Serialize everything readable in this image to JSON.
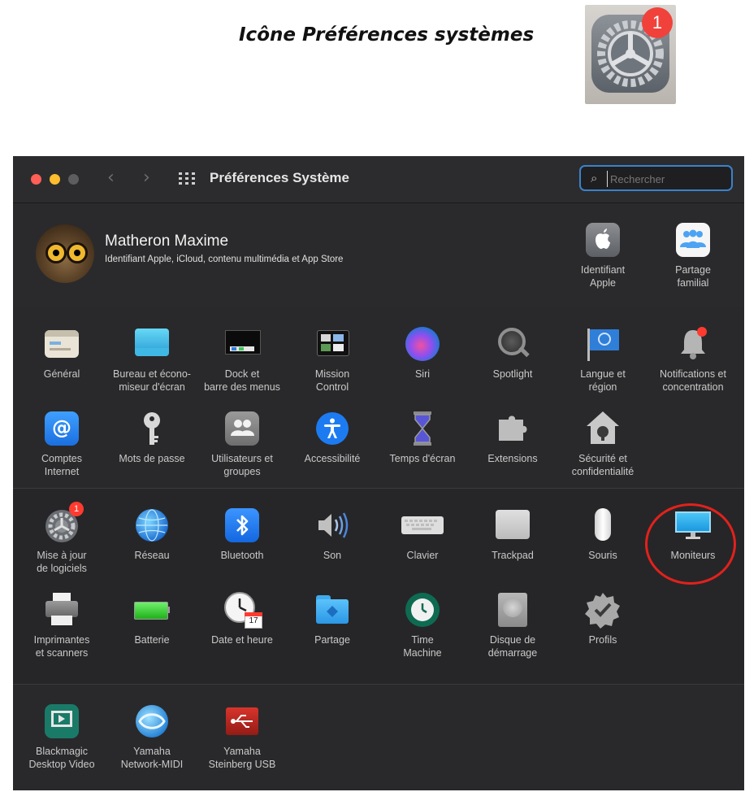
{
  "caption": "Icône Préférences systèmes",
  "app_icon": {
    "badge": "1",
    "icon": "system-preferences-gear-icon"
  },
  "window": {
    "title": "Préférences Système",
    "search_placeholder": "Rechercher",
    "traffic_lights": {
      "close": "#ff5f57",
      "minimize": "#febc2e",
      "zoom": "#5d5d5f"
    }
  },
  "account": {
    "name": "Matheron Maxime",
    "subtitle": "Identifiant Apple, iCloud, contenu multimédia et App Store",
    "items": [
      {
        "label": "Identifiant\nApple",
        "icon": "apple-id-icon"
      },
      {
        "label": "Partage\nfamilial",
        "icon": "family-sharing-icon"
      }
    ]
  },
  "section1": [
    {
      "label": "Général",
      "icon": "general-icon"
    },
    {
      "label": "Bureau et écono-\nmiseur d'écran",
      "icon": "desktop-screensaver-icon"
    },
    {
      "label": "Dock et\nbarre des menus",
      "icon": "dock-icon"
    },
    {
      "label": "Mission\nControl",
      "icon": "mission-control-icon"
    },
    {
      "label": "Siri",
      "icon": "siri-icon"
    },
    {
      "label": "Spotlight",
      "icon": "spotlight-icon"
    },
    {
      "label": "Langue et\nrégion",
      "icon": "language-region-icon"
    },
    {
      "label": "Notifications et\nconcentration",
      "icon": "notifications-icon"
    },
    {
      "label": "Comptes\nInternet",
      "icon": "internet-accounts-icon"
    },
    {
      "label": "Mots de passe",
      "icon": "passwords-icon"
    },
    {
      "label": "Utilisateurs et\ngroupes",
      "icon": "users-groups-icon"
    },
    {
      "label": "Accessibilité",
      "icon": "accessibility-icon"
    },
    {
      "label": "Temps d'écran",
      "icon": "screen-time-icon"
    },
    {
      "label": "Extensions",
      "icon": "extensions-icon"
    },
    {
      "label": "Sécurité et\nconfidentialité",
      "icon": "security-privacy-icon"
    }
  ],
  "section2": [
    {
      "label": "Mise à jour\nde logiciels",
      "icon": "software-update-icon",
      "badge": "1"
    },
    {
      "label": "Réseau",
      "icon": "network-icon"
    },
    {
      "label": "Bluetooth",
      "icon": "bluetooth-icon"
    },
    {
      "label": "Son",
      "icon": "sound-icon"
    },
    {
      "label": "Clavier",
      "icon": "keyboard-icon"
    },
    {
      "label": "Trackpad",
      "icon": "trackpad-icon"
    },
    {
      "label": "Souris",
      "icon": "mouse-icon"
    },
    {
      "label": "Moniteurs",
      "icon": "displays-icon"
    },
    {
      "label": "Imprimantes\net scanners",
      "icon": "printers-scanners-icon"
    },
    {
      "label": "Batterie",
      "icon": "battery-icon"
    },
    {
      "label": "Date et heure",
      "icon": "date-time-icon",
      "day": "17"
    },
    {
      "label": "Partage",
      "icon": "sharing-icon"
    },
    {
      "label": "Time\nMachine",
      "icon": "time-machine-icon"
    },
    {
      "label": "Disque de\ndémarrage",
      "icon": "startup-disk-icon"
    },
    {
      "label": "Profils",
      "icon": "profiles-icon"
    }
  ],
  "section3": [
    {
      "label": "Blackmagic\nDesktop Video",
      "icon": "blackmagic-icon"
    },
    {
      "label": "Yamaha\nNetwork-MIDI",
      "icon": "yamaha-midi-icon"
    },
    {
      "label": "Yamaha\nSteinberg USB",
      "icon": "yamaha-steinberg-usb-icon"
    }
  ],
  "annotation": {
    "highlight": "Moniteurs",
    "color": "#e2211c"
  }
}
